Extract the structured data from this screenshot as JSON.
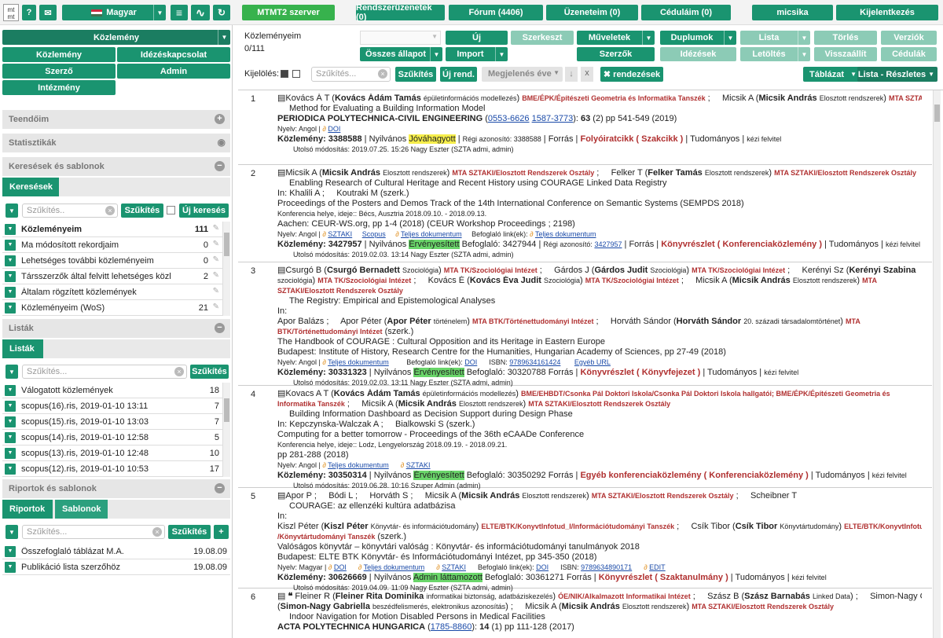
{
  "topbar": {
    "logo": "mt mt",
    "help": "?",
    "mail": "✉",
    "language": "Magyar",
    "menu": "≡",
    "pulse": "∿",
    "refresh": "↻",
    "server": "MTMT2 szerver",
    "system_messages": "Rendszerüzenetek (0)",
    "forum": "Fórum (4406)",
    "my_messages": "Üzeneteim (0)",
    "my_targets": "Céduláim (0)",
    "user": "micsika",
    "logout": "Kijelentkezés"
  },
  "left": {
    "type_select": "Közlemény",
    "nav": [
      "Közlemény",
      "Idézéskapcsolat",
      "Szerző",
      "Admin",
      "Intézmény"
    ],
    "sections": {
      "todo": "Teendőim",
      "stats": "Statisztikák",
      "searches": "Keresések és sablonok",
      "lists": "Listák",
      "reports": "Riportok és sablonok"
    },
    "search_tab": "Keresések",
    "filter_placeholder": "Szűkítés..",
    "filter_button": "Szűkítés",
    "new_search": "Új keresés",
    "searches": [
      {
        "label": "Közleményeim",
        "count": "111",
        "bold": true
      },
      {
        "label": "Ma módosított rekordjaim",
        "count": "0"
      },
      {
        "label": "Lehetséges további közleményeim",
        "count": "0"
      },
      {
        "label": "Társszerzők által felvitt lehetséges közle",
        "count": "2"
      },
      {
        "label": "Általam rögzített közlemények",
        "count": ""
      },
      {
        "label": "Közleményeim (WoS)",
        "count": "21"
      }
    ],
    "lists_tab": "Listák",
    "lists_filter_placeholder": "Szűkítés...",
    "lists": [
      {
        "label": "Válogatott közlemények",
        "count": "18"
      },
      {
        "label": "scopus(16).ris, 2019-01-10 13:11",
        "count": "7"
      },
      {
        "label": "scopus(15).ris, 2019-01-10 13:03",
        "count": "7"
      },
      {
        "label": "scopus(14).ris, 2019-01-10 12:58",
        "count": "5"
      },
      {
        "label": "scopus(13).ris, 2019-01-10 12:48",
        "count": "10"
      },
      {
        "label": "scopus(12).ris, 2019-01-10 10:53",
        "count": "17"
      }
    ],
    "report_tabs": [
      "Riportok",
      "Sablonok"
    ],
    "reports_filter_placeholder": "Szűkítés...",
    "plus": "+",
    "reports": [
      {
        "label": "Összefoglaló táblázat M.A.",
        "date": "19.08.09"
      },
      {
        "label": "Publikáció lista szerzőhöz",
        "date": "19.08.09"
      }
    ]
  },
  "toolbar": {
    "title": "Közleményeim",
    "count": "0/111",
    "new": "Új",
    "edit": "Szerkeszt",
    "operations": "Műveletek",
    "duplicates": "Duplumok",
    "list": "Lista",
    "delete": "Törlés",
    "versions": "Verziók",
    "all_states": "Összes állapot",
    "import": "Import",
    "authors": "Szerzők",
    "citations": "Idézések",
    "downloads": "Letöltés",
    "restore": "Visszaállít",
    "targets": "Cédulák",
    "select_label": "Kijelölés:",
    "filter_placeholder": "Szűkítés...",
    "filter_btn": "Szűkítés",
    "new_order": "Új rend.",
    "year": "Megjelenés éve",
    "down_arrow": "↓",
    "x": "x",
    "orders": "✖ rendezések",
    "table": "Táblázat",
    "list_detailed": "Lista - Részletes"
  },
  "records": [
    {
      "num": "1",
      "lines": [
        "<span>▤Kovács Á T (<b>Kovács Ádám Tamás</b> <span class='sm'>épületinformációs modellezés</span>) <span class='red'>BME/ÉPK/Építészeti Geometria és Informatika Tanszék</span> ; &nbsp;&nbsp;&nbsp; Micsik A (<b>Micsik András</b> <span class='sm'>Elosztott rendszerek</span>) <span class='red'>MTA SZTAKI/Elosztott Rendszerek Osztály</span></span>",
        "<span style='padding-left:15px'>Method for Evaluating a Building Information Model</span>",
        "<b>PERIODICA POLYTECHNICA-CIVIL ENGINEERING</b> (<span class='lnk'>0553-6626</span> <span class='lnk'>1587-3773</span>): <b>63</b> (2) pp 541-549 (2019)",
        "<span class='small'>Nyelv: Angol | <span style='color:#e09020'>∂</span> <span class='lnk'>DOI</span></span>",
        "<b>Közlemény: 3388588</b> | Nyilvános <span class='hy'>Jóváhagyott</span> | <span class='sm'>Régi azonosító: 3388588</span> | Forrás | <span class='kind'>Folyóiratcikk ( Szakcikk )</span> | Tudományos | <span class='sm'>kézi felvitel</span>",
        "<span class='small' style='padding-left:20px'>Utolsó módosítás: 2019.07.25. 15:26 Nagy Eszter (SZTA admi, admin)</span>"
      ]
    },
    {
      "num": "2",
      "lines": [
        "▤Micsik A (<b>Micsik András</b> <span class='sm'>Elosztott rendszerek</span>) <span class='red'>MTA SZTAKI/Elosztott Rendszerek Osztály</span> ; &nbsp;&nbsp;&nbsp; Felker T (<b>Felker Tamás</b> <span class='sm'>Elosztott rendszerek</span>) <span class='red'>MTA SZTAKI/Elosztott Rendszerek Osztály</span>",
        "<span style='padding-left:15px'>Enabling Research of Cultural Heritage and Recent History using COURAGE Linked Data Registry</span>",
        "In: Khalili A ; &nbsp;&nbsp;&nbsp; Koutraki M (szerk.)",
        "Proceedings of the Posters and Demos Track of the 14th International Conference on Semantic Systems (SEMPDS 2018)",
        "<span class='sm'>Konferencia helye, ideje:: Bécs, Ausztria 2018.09.10. - 2018.09.13.</span>",
        "Aachen: CEUR-WS.org, pp 1-4 (2018) (CEUR Workshop Proceedings ; 2198)",
        "<span class='small'>Nyelv: Angol | <span style='color:#e09020'>∂</span> <span class='lnk'>SZTAKI</span> &nbsp;&nbsp;&nbsp; <span class='lnk'>Scopus</span> &nbsp;&nbsp;&nbsp; <span style='color:#e09020'>∂</span> <span class='lnk'>Teljes dokumentum</span> &nbsp;&nbsp;&nbsp; Befoglaló link(ek): <span style='color:#e09020'>∂</span> <span class='lnk'>Teljes dokumentum</span></span>",
        "<b>Közlemény: 3427957</b> | Nyilvános <span class='hg'>Érvényesített</span> Befoglaló: 3427944 | <span class='sm'>Régi azonosító: <span class='lnk'>3427957</span></span> | Forrás | <span class='kind'>Könyvrészlet ( Konferenciaközlemény )</span> | Tudományos | <span class='sm'>kézi felvitel</span>",
        "<span class='small' style='padding-left:20px'>Utolsó módosítás: 2019.02.03. 13:14 Nagy Eszter (SZTA admi, admin)</span>"
      ]
    },
    {
      "num": "3",
      "lines": [
        "▤Csurgó B (<b>Csurgó Bernadett</b> <span class='sm'>Szociológia</span>) <span class='red'>MTA TK/Szociológiai Intézet</span> ; &nbsp;&nbsp;&nbsp; Gárdos J (<b>Gárdos Judit</b> <span class='sm'>Szociológia</span>) <span class='red'>MTA TK/Szociológiai Intézet</span> ; &nbsp;&nbsp;&nbsp; Kerényi Sz (<b>Kerényi Szabina</b>",
        "<span class='sm'>szociológia</span>) <span class='red'>MTA TK/Szociológiai Intézet</span> ; &nbsp;&nbsp;&nbsp; Kovács É (<b>Kovács Éva Judit</b> <span class='sm'>Szociológia</span>) <span class='red'>MTA TK/Szociológiai Intézet</span> ; &nbsp;&nbsp;&nbsp; Micsik A (<b>Micsik András</b> <span class='sm'>Elosztott rendszerek</span>) <span class='red'>MTA</span>",
        "<span class='red'>SZTAKI/Elosztott Rendszerek Osztály</span>",
        "<span style='padding-left:15px'>The Registry: Empirical and Epistemological Analyses</span>",
        "In:",
        "Apor Balázs ; &nbsp;&nbsp;&nbsp; Apor Péter (<b>Apor Péter</b> <span class='sm'>történelem</span>) <span class='red'>MTA BTK/Történettudományi Intézet</span> ; &nbsp;&nbsp;&nbsp; Horváth Sándor (<b>Horváth Sándor</b> <span class='sm'>20. századi társadalomtörténet</span>) <span class='red'>MTA</span>",
        "<span class='red'>BTK/Történettudományi Intézet</span> (szerk.)",
        "The Handbook of COURAGE : Cultural Opposition and its Heritage in Eastern Europe",
        "Budapest: Institute of History, Research Centre for the Humanities, Hungarian Academy of Sciences, pp 27-49 (2018)",
        "<span class='small'>Nyelv: Angol | <span style='color:#e09020'>∂</span> <span class='lnk'>Teljes dokumentum</span> &nbsp;&nbsp;&nbsp;&nbsp;&nbsp;&nbsp;&nbsp; Befoglaló link(ek): <span class='lnk'>DOI</span> &nbsp;&nbsp;&nbsp;&nbsp; ISBN: <span class='lnk'>9789634161424</span> &nbsp;&nbsp;&nbsp;&nbsp;&nbsp; <span class='lnk'>Egyéb URL</span></span>",
        "<b>Közlemény: 30331323</b> | Nyilvános <span class='hg'>Érvényesített</span> Befoglaló: 30320788 Forrás | <span class='kind'>Könyvrészlet ( Könyvfejezet )</span> | Tudományos | <span class='sm'>kézi felvitel</span>",
        "<span class='small' style='padding-left:20px'>Utolsó módosítás: 2019.02.03. 13:11 Nagy Eszter (SZTA admi, admin)</span>"
      ]
    },
    {
      "num": "4",
      "lines": [
        "▤Kovacs A T (<b>Kovács Ádám Tamás</b> <span class='sm'>épületinformációs modellezés</span>) <span class='red'>BME/EHBDT/Csonka Pál Doktori Iskola/Csonka Pál Doktori Iskola hallgatói; BME/ÉPK/Építészeti Geometria és</span>",
        "<span class='red'>Informatika Tanszék</span> ; &nbsp;&nbsp;&nbsp; Micsik A (<b>Micsik András</b> <span class='sm'>Elosztott rendszerek</span>) <span class='red'>MTA SZTAKI/Elosztott Rendszerek Osztály</span>",
        "<span style='padding-left:15px'>Building Information Dashboard as Decision Support during Design Phase</span>",
        "In: Kepczynska-Walczak A ; &nbsp;&nbsp;&nbsp; Bialkowski S (szerk.)",
        "Computing for a better tomorrow - Proceedings of the 36th eCAADe Conference",
        "<span class='sm'>Konferencia helye, ideje:: Lodz, Lengyelország 2018.09.19. - 2018.09.21.</span>",
        "pp 281-288 (2018)",
        "<span class='small'>Nyelv: Angol | <span style='color:#e09020'>∂</span> <span class='lnk'>Teljes dokumentum</span> &nbsp;&nbsp;&nbsp;&nbsp; <span style='color:#e09020'>∂</span> <span class='lnk'>SZTAKI</span></span>",
        "<b>Közlemény: 30350314</b> | Nyilvános <span class='hg'>Érvényesített</span> Befoglaló: 30350292 Forrás | <span class='kind'>Egyéb konferenciaközlemény ( Konferenciaközlemény )</span> | Tudományos | <span class='sm'>kézi felvitel</span>",
        "<span class='small' style='padding-left:20px'>Utolsó módosítás: 2019.06.28. 10:16 Szuper Admin (admin)</span>"
      ]
    },
    {
      "num": "5",
      "lines": [
        "▤Apor P ; &nbsp;&nbsp;&nbsp; Bódi L ; &nbsp;&nbsp;&nbsp; Horváth S ; &nbsp;&nbsp;&nbsp; Micsik A (<b>Micsik András</b> <span class='sm'>Elosztott rendszerek</span>) <span class='red'>MTA SZTAKI/Elosztott Rendszerek Osztály</span> ; &nbsp;&nbsp;&nbsp; Scheibner T",
        "<span style='padding-left:15px'>COURAGE: az ellenzéki kultúra adatbázisa</span>",
        "In:",
        "Kiszl Péter (<b>Kiszl Péter</b> <span class='sm'>Könyvtár- és információtudomány</span>) <span class='red'>ELTE/BTK/KonyvtInfotud_I/Információtudományi Tanszék</span> ; &nbsp;&nbsp;&nbsp; Csík Tibor (<b>Csík Tibor</b> <span class='sm'>Könyvtártudomány</span>) <span class='red'>ELTE/BTK/KonyvtInfotud_I</span>",
        "<span class='red'>/Könyvtártudományi Tanszék</span> (szerk.)",
        "Valóságos könyvtár – könyvtári valóság : Könyvtár- és információtudományi tanulmányok 2018",
        "Budapest: ELTE BTK Könyvtár- és Információtudományi Intézet, pp 345-350 (2018)",
        "<span class='small'>Nyelv: Magyar | <span style='color:#e09020'>∂</span> <span class='lnk'>DOI</span> &nbsp;&nbsp;&nbsp;&nbsp; <span style='color:#e09020'>∂</span> <span class='lnk'>Teljes dokumentum</span> &nbsp;&nbsp;&nbsp;&nbsp; <span style='color:#e09020'>∂</span> <span class='lnk'>SZTAKI</span> &nbsp;&nbsp;&nbsp;&nbsp; Befoglaló link(ek): <span class='lnk'>DOI</span> &nbsp;&nbsp;&nbsp;&nbsp; ISBN: <span class='lnk'>9789634890171</span> &nbsp;&nbsp;&nbsp;&nbsp; <span style='color:#e09020'>∂</span> <span class='lnk'>EDIT</span></span>",
        "<b>Közlemény: 30626669</b> | Nyilvános <span class='hg'>Admin láttamozott</span> Befoglaló: 30361271 Forrás | <span class='kind'>Könyvrészlet ( Szaktanulmány )</span> | Tudományos | <span class='sm'>kézi felvitel</span>",
        "<span class='small' style='padding-left:20px'>Utolsó módosítás: 2019.04.09. 11:09 Nagy Eszter (SZTA admi, admin)</span>"
      ]
    },
    {
      "num": "6",
      "lines": [
        "▤ <b>❝</b> Fleiner R (<b>Fleiner Rita Dominika</b> <span class='sm'>informatikai biztonság, adatbáziskezelés</span>) <span class='red'>ÓE/NIK/Alkalmazott Informatikai Intézet</span> ; &nbsp;&nbsp;&nbsp; Szász B (<b>Szász Barnabás</b> <span class='sm'>Linked Data</span>) ; &nbsp;&nbsp;&nbsp; Simon-Nagy G",
        "(<b>Simon-Nagy Gabriella</b> <span class='sm'>beszédfelismerés, elektronikus azonosítás</span>) ; &nbsp;&nbsp;&nbsp; Micsik A (<b>Micsik András</b> <span class='sm'>Elosztott rendszerek</span>) <span class='red'>MTA SZTAKI/Elosztott Rendszerek Osztály</span>",
        "<span style='padding-left:15px'>Indoor Navigation for Motion Disabled Persons in Medical Facilities</span>",
        "<b>ACTA POLYTECHNICA HUNGARICA</b> (<span class='lnk'>1785-8860</span>): <b>14</b> (1) pp 111-128 (2017)"
      ]
    }
  ]
}
